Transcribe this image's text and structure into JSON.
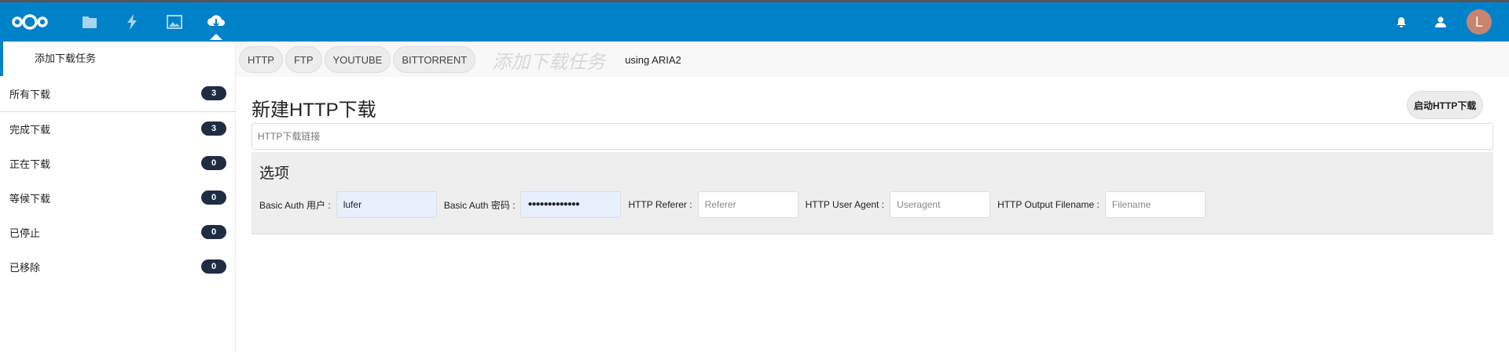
{
  "header": {
    "icons": [
      "nextcloud-logo",
      "files-icon",
      "activity-icon",
      "gallery-icon",
      "download-cloud-icon",
      "bell-icon",
      "contacts-icon"
    ],
    "avatar_letter": "L",
    "accent": "#0082c9",
    "avatar_color": "#c9846f"
  },
  "sidebar": {
    "add_task": "添加下载任务",
    "items": [
      {
        "label": "所有下载",
        "count": "3"
      },
      {
        "label": "完成下载",
        "count": "3"
      },
      {
        "label": "正在下载",
        "count": "0"
      },
      {
        "label": "等候下载",
        "count": "0"
      },
      {
        "label": "已停止",
        "count": "0"
      },
      {
        "label": "已移除",
        "count": "0"
      }
    ]
  },
  "tabs": [
    "HTTP",
    "FTP",
    "YOUTUBE",
    "BITTORRENT"
  ],
  "tab_watermark": "添加下载任务",
  "using_prefix": "using ",
  "using_engine": "ARIA2",
  "main": {
    "title": "新建HTTP下载",
    "start_button": "启动HTTP下载",
    "url_placeholder": "HTTP下载链接",
    "options": {
      "title": "选项",
      "fields": [
        {
          "label": "Basic Auth 用户 :",
          "value": "lufer",
          "placeholder": ""
        },
        {
          "label": "Basic Auth 密码 :",
          "value": "●●●●●●●●●●●●●",
          "placeholder": ""
        },
        {
          "label": "HTTP Referer :",
          "value": "",
          "placeholder": "Referer"
        },
        {
          "label": "HTTP User Agent :",
          "value": "",
          "placeholder": "Useragent"
        },
        {
          "label": "HTTP Output Filename :",
          "value": "",
          "placeholder": "Filename"
        }
      ]
    }
  }
}
